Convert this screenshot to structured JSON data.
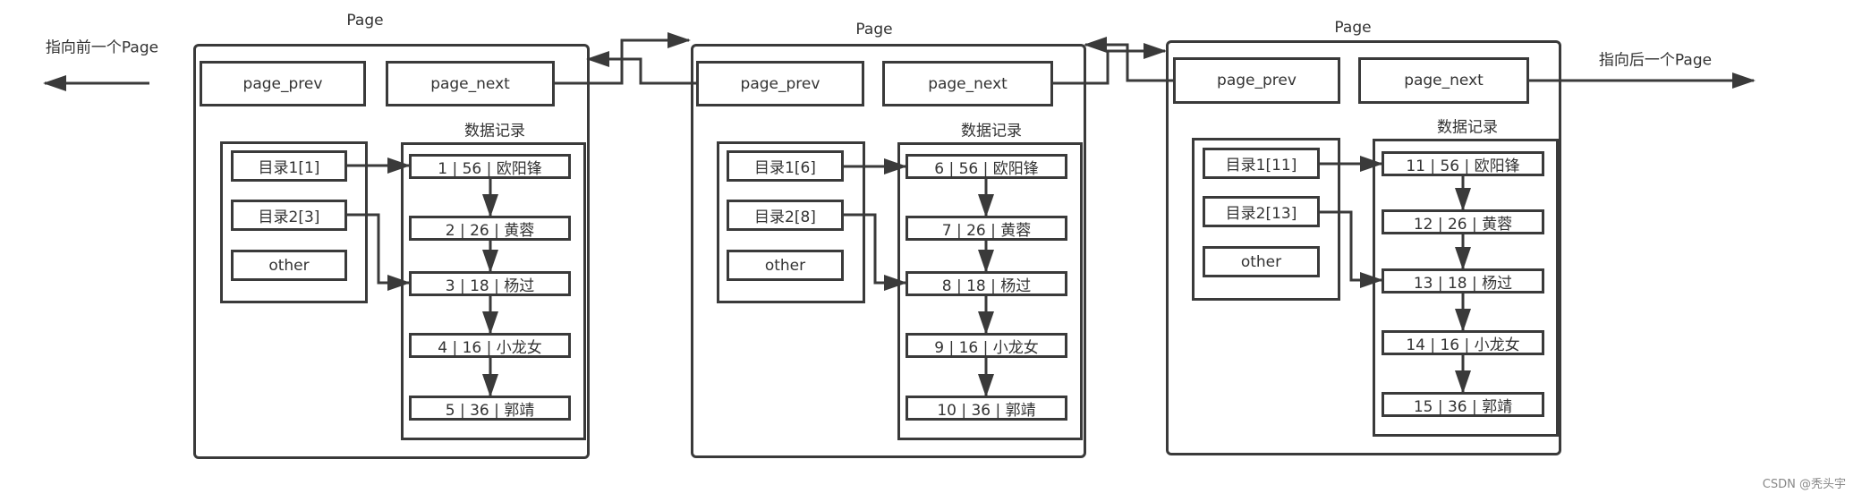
{
  "labels": {
    "prev_pointer": "指向前一个Page",
    "next_pointer": "指向后一个Page",
    "watermark": "CSDN @秃头宇"
  },
  "pages": [
    {
      "title": "Page",
      "prev_field": "page_prev",
      "next_field": "page_next",
      "records_title": "数据记录",
      "directory": [
        "目录1[1]",
        "目录2[3]",
        "other"
      ],
      "records": [
        "1 | 56 | 欧阳锋",
        "2 | 26 | 黄蓉",
        "3 | 18 | 杨过",
        "4 | 16 | 小龙女",
        "5 | 36 | 郭靖"
      ]
    },
    {
      "title": "Page",
      "prev_field": "page_prev",
      "next_field": "page_next",
      "records_title": "数据记录",
      "directory": [
        "目录1[6]",
        "目录2[8]",
        "other"
      ],
      "records": [
        "6 |  56 | 欧阳锋",
        "7 |  26 | 黄蓉",
        "8 |  18 | 杨过",
        "9 |  16 | 小龙女",
        "10 |  36 | 郭靖"
      ]
    },
    {
      "title": "Page",
      "prev_field": "page_prev",
      "next_field": "page_next",
      "records_title": "数据记录",
      "directory": [
        "目录1[11]",
        "目录2[13]",
        "other"
      ],
      "records": [
        "11 |  56 | 欧阳锋",
        "12 |  26 | 黄蓉",
        "13 |  18 | 杨过",
        "14 |  16 | 小龙女",
        "15 |  36 | 郭靖"
      ]
    }
  ],
  "colors": {
    "line": "#3a3a3a",
    "text": "#333333"
  }
}
